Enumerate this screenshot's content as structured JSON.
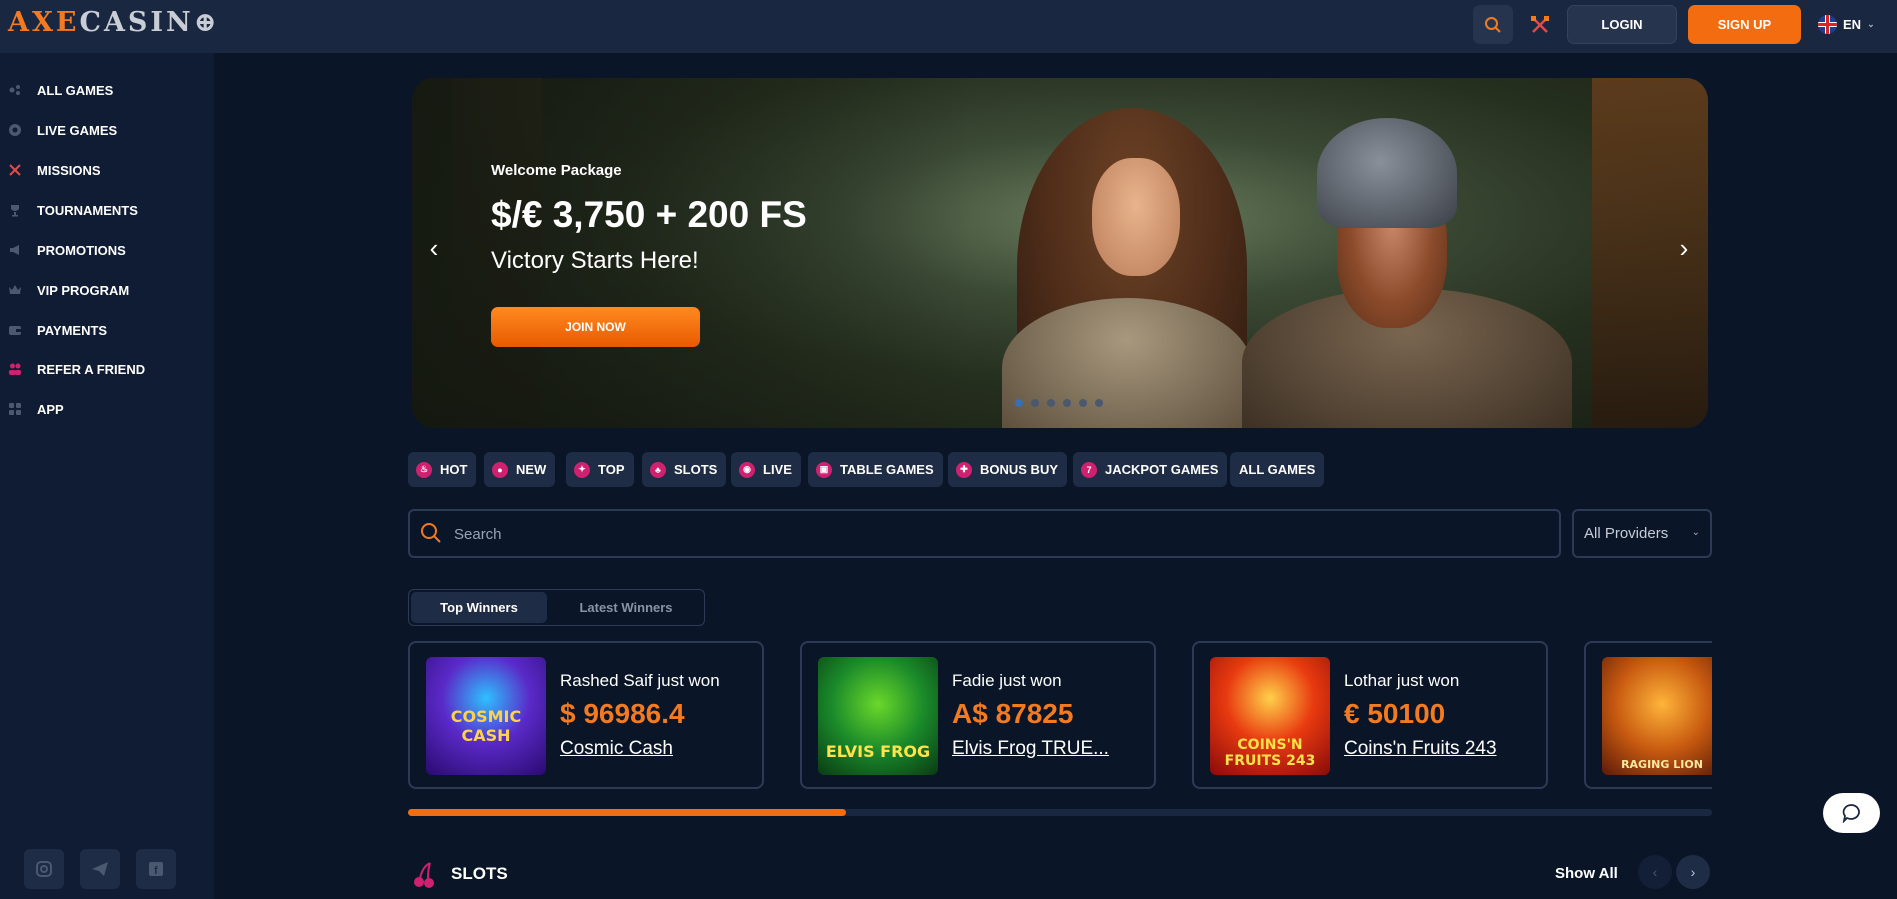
{
  "header": {
    "logo_part1": "AXE",
    "logo_part2": "CASIN",
    "logo_part3": "⊕",
    "search_icon": "search-icon",
    "login_label": "LOGIN",
    "signup_label": "SIGN UP",
    "language": "EN"
  },
  "sidebar": {
    "items": [
      {
        "label": "ALL GAMES",
        "icon": "gamepad-icon"
      },
      {
        "label": "LIVE GAMES",
        "icon": "live-chip-icon"
      },
      {
        "label": "MISSIONS",
        "icon": "crossed-axes-icon"
      },
      {
        "label": "TOURNAMENTS",
        "icon": "trophy-icon"
      },
      {
        "label": "PROMOTIONS",
        "icon": "megaphone-icon"
      },
      {
        "label": "VIP PROGRAM",
        "icon": "crown-icon"
      },
      {
        "label": "PAYMENTS",
        "icon": "wallet-icon"
      },
      {
        "label": "REFER A FRIEND",
        "icon": "friends-icon"
      },
      {
        "label": "APP",
        "icon": "app-grid-icon"
      }
    ],
    "socials": [
      "instagram-icon",
      "telegram-icon",
      "facebook-icon"
    ]
  },
  "hero": {
    "subtitle": "Welcome Package",
    "title": "$/€ 3,750 + 200 FS",
    "tagline": "Victory Starts Here!",
    "cta": "JOIN NOW",
    "slides": 6,
    "active_slide": 1
  },
  "categories": [
    {
      "label": "HOT",
      "icon": "fire-icon"
    },
    {
      "label": "NEW",
      "icon": "new-badge-icon"
    },
    {
      "label": "TOP",
      "icon": "top-icon"
    },
    {
      "label": "SLOTS",
      "icon": "cherry-icon"
    },
    {
      "label": "LIVE",
      "icon": "live-chip-icon"
    },
    {
      "label": "TABLE GAMES",
      "icon": "cards-icon"
    },
    {
      "label": "BONUS BUY",
      "icon": "gift-icon"
    },
    {
      "label": "JACKPOT GAMES",
      "icon": "seven-icon"
    },
    {
      "label": "ALL GAMES",
      "icon": ""
    }
  ],
  "search": {
    "placeholder": "Search",
    "providers": "All Providers"
  },
  "winners": {
    "tab_top": "Top Winners",
    "tab_latest": "Latest Winners",
    "cards": [
      {
        "name": "Rashed Saif just won",
        "amount": "$ 96986.4",
        "game": "Cosmic Cash",
        "thumb_text": "COSMIC CASH"
      },
      {
        "name": "Fadie just won",
        "amount": "A$ 87825",
        "game": "Elvis Frog TRUE...",
        "thumb_text": "ELVIS FROG"
      },
      {
        "name": "Lothar just won",
        "amount": "€ 50100",
        "game": "Coins'n Fruits 243",
        "thumb_text": "COINS'N FRUITS 243"
      },
      {
        "name": "",
        "amount": "",
        "game": "",
        "thumb_text": "RAGING LION"
      }
    ],
    "progress_fraction": 0.336
  },
  "slots_section": {
    "title": "SLOTS",
    "show_all": "Show All"
  },
  "colors": {
    "accent": "#f46c10",
    "background": "#0a1528",
    "header": "#1a2740",
    "sidebar": "#101c33"
  }
}
